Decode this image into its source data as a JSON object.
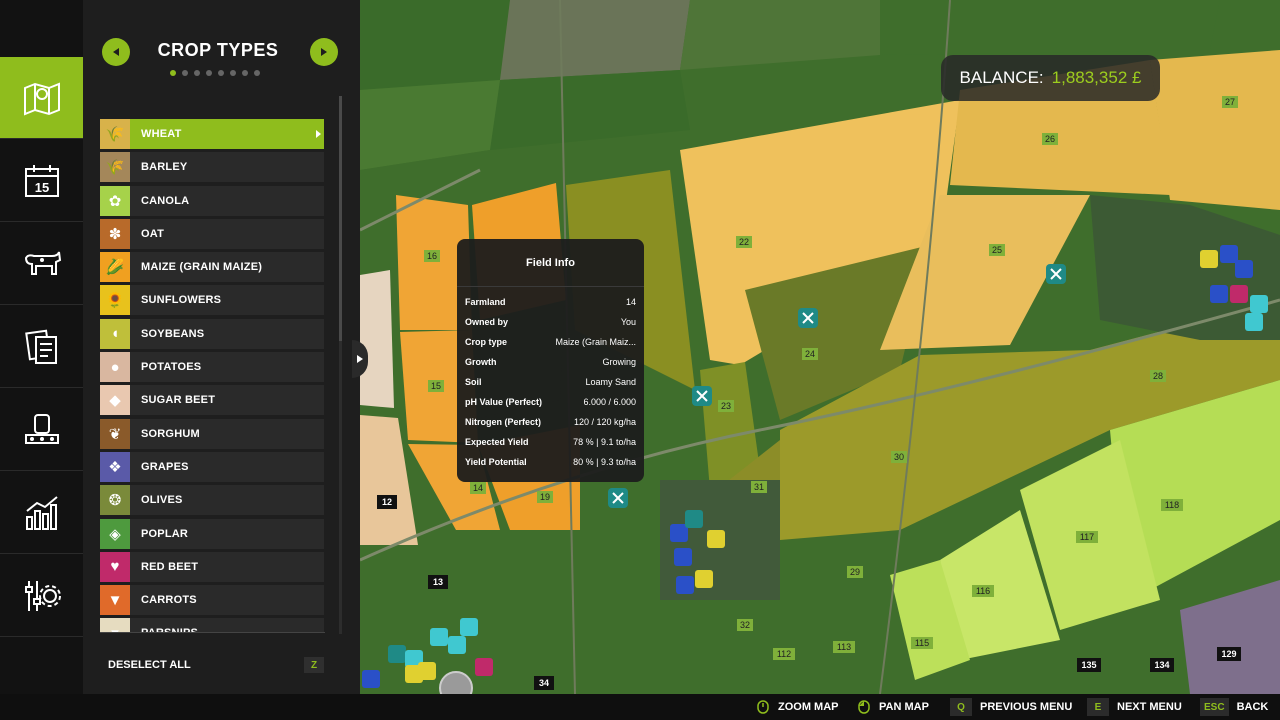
{
  "rail": {
    "items": [
      {
        "name": "map",
        "icon": "map-icon",
        "active": true
      },
      {
        "name": "calendar",
        "icon": "calendar-icon",
        "day": "15",
        "active": false
      },
      {
        "name": "animals",
        "icon": "cow-icon",
        "active": false
      },
      {
        "name": "contracts",
        "icon": "documents-icon",
        "active": false
      },
      {
        "name": "production",
        "icon": "factory-icon",
        "active": false
      },
      {
        "name": "statistics",
        "icon": "bar-chart-icon",
        "active": false
      },
      {
        "name": "settings",
        "icon": "sliders-gear-icon",
        "active": false
      }
    ]
  },
  "panel": {
    "title": "CROP TYPES",
    "page_dots": 8,
    "active_dot": 0,
    "crops": [
      {
        "label": "WHEAT",
        "color": "#d8b24a",
        "glyph": "🌾",
        "selected": true
      },
      {
        "label": "BARLEY",
        "color": "#a4875a",
        "glyph": "🌾"
      },
      {
        "label": "CANOLA",
        "color": "#a6d24a",
        "glyph": "✿"
      },
      {
        "label": "OAT",
        "color": "#b86a2a",
        "glyph": "✽"
      },
      {
        "label": "MAIZE (GRAIN MAIZE)",
        "color": "#f0a020",
        "glyph": "🌽"
      },
      {
        "label": "SUNFLOWERS",
        "color": "#e8c21c",
        "glyph": "🌻"
      },
      {
        "label": "SOYBEANS",
        "color": "#bfbf3a",
        "glyph": "◖"
      },
      {
        "label": "POTATOES",
        "color": "#d9b7a0",
        "glyph": "●"
      },
      {
        "label": "SUGAR BEET",
        "color": "#e9c8b0",
        "glyph": "◆"
      },
      {
        "label": "SORGHUM",
        "color": "#8a5a2a",
        "glyph": "❦"
      },
      {
        "label": "GRAPES",
        "color": "#5a5aa8",
        "glyph": "❖"
      },
      {
        "label": "OLIVES",
        "color": "#7a8a3a",
        "glyph": "❂"
      },
      {
        "label": "POPLAR",
        "color": "#4e9a3e",
        "glyph": "◈"
      },
      {
        "label": "RED BEET",
        "color": "#c02a6a",
        "glyph": "♥"
      },
      {
        "label": "CARROTS",
        "color": "#e06a2a",
        "glyph": "▼"
      },
      {
        "label": "PARSNIPS",
        "color": "#e6dcc0",
        "glyph": "▾"
      }
    ],
    "deselect_label": "DESELECT ALL",
    "deselect_key": "Z"
  },
  "balance": {
    "label": "BALANCE:",
    "value": "1,883,352 £"
  },
  "field_info": {
    "title": "Field Info",
    "rows": [
      {
        "k": "Farmland",
        "v": "14"
      },
      {
        "k": "Owned by",
        "v": "You"
      },
      {
        "k": "Crop type",
        "v": "Maize (Grain Maiz..."
      },
      {
        "k": "Growth",
        "v": "Growing"
      },
      {
        "k": "Soil",
        "v": "Loamy Sand"
      },
      {
        "k": "pH Value (Perfect)",
        "v": "6.000 / 6.000"
      },
      {
        "k": "Nitrogen (Perfect)",
        "v": "120 / 120 kg/ha"
      },
      {
        "k": "Expected Yield",
        "v": "78 % | 9.1 to/ha"
      },
      {
        "k": "Yield Potential",
        "v": "80 % | 9.3 to/ha"
      }
    ]
  },
  "map_labels": {
    "f16": "16",
    "f15": "15",
    "f14": "14",
    "f19": "19",
    "f22": "22",
    "f23": "23",
    "f24": "24",
    "f25": "25",
    "f26": "26",
    "f27": "27",
    "f28": "28",
    "f29": "29",
    "f30": "30",
    "f31": "31",
    "f32": "32",
    "f112": "112",
    "f113": "113",
    "f115": "115",
    "f116": "116",
    "f117": "117",
    "f118": "118",
    "f12": "12",
    "f13": "13",
    "f34": "34",
    "f135": "135",
    "f134": "134",
    "f129": "129",
    "f33": "33"
  },
  "bottom_bar": {
    "zoom": "ZOOM MAP",
    "pan": "PAN MAP",
    "prev_key": "Q",
    "prev": "PREVIOUS MENU",
    "next_key": "E",
    "next": "NEXT MENU",
    "back_key": "ESC",
    "back": "BACK"
  },
  "colors": {
    "accent": "#8fbd1d",
    "balance_value": "#9ccd1e"
  }
}
